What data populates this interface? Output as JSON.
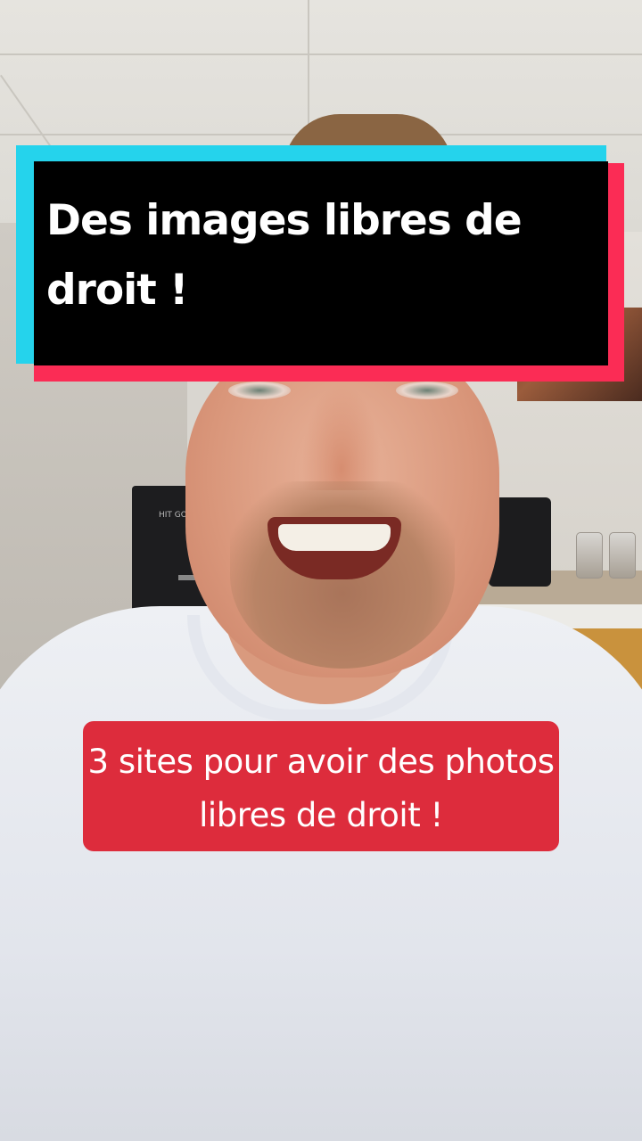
{
  "overlay": {
    "title": "Des images libres de droit !",
    "caption": "3 sites pour avoir des photos libres de droit !"
  },
  "background": {
    "fridge_label": "HIT GOLD"
  },
  "colors": {
    "banner_cyan": "#25d3ec",
    "banner_red": "#fb2c55",
    "banner_black": "#000000",
    "caption_red": "#dd2c3c",
    "text_white": "#ffffff"
  }
}
